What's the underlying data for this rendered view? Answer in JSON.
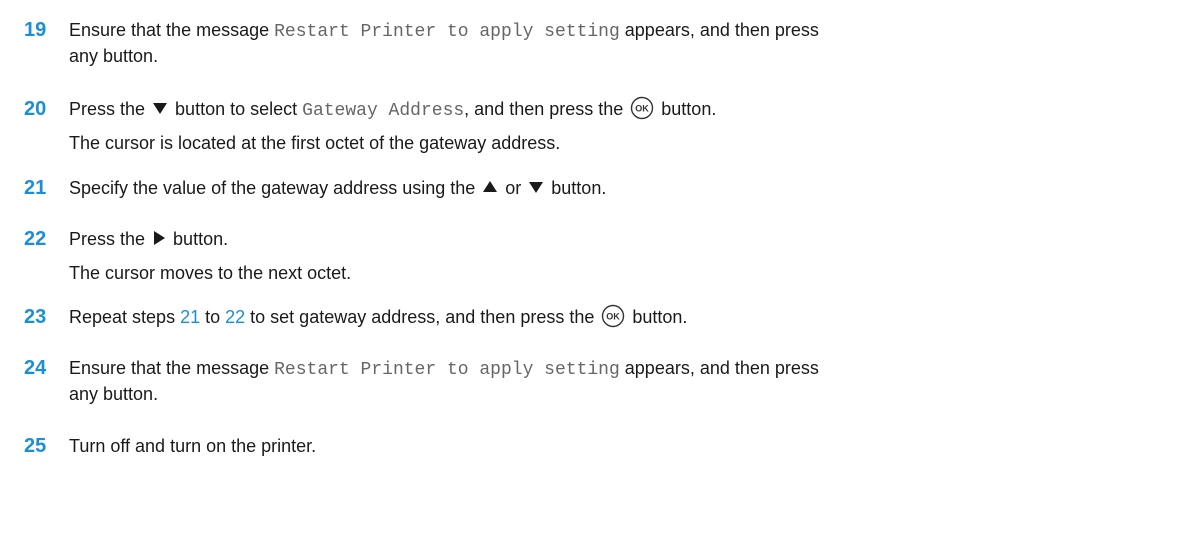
{
  "steps": [
    {
      "number": "19",
      "line1_pre": "Ensure that the message ",
      "line1_mono": "Restart Printer to apply setting",
      "line1_post": " appears, and then press",
      "line2": "any button."
    },
    {
      "number": "20",
      "pre": "Press the ",
      "mid1": " button to select ",
      "mono": "Gateway Address",
      "mid2": ", and then press the ",
      "post": " button.",
      "sub": "The cursor is located at the first octet of the gateway address."
    },
    {
      "number": "21",
      "pre": "Specify the value of the gateway address using the ",
      "mid": " or ",
      "post": " button."
    },
    {
      "number": "22",
      "pre": "Press the ",
      "post": " button.",
      "sub": "The cursor moves to the next octet."
    },
    {
      "number": "23",
      "pre": "Repeat steps ",
      "link1": "21",
      "mid1": " to ",
      "link2": "22",
      "mid2": " to set gateway address, and then press the ",
      "post": " button."
    },
    {
      "number": "24",
      "line1_pre": "Ensure that the message ",
      "line1_mono": "Restart Printer to apply setting",
      "line1_post": " appears, and then press",
      "line2": "any button."
    },
    {
      "number": "25",
      "text": "Turn off and turn on the printer."
    }
  ],
  "icons": {
    "ok_label": "OK",
    "down": "down-arrow-icon",
    "up": "up-arrow-icon",
    "right": "right-arrow-icon",
    "ok": "ok-button-icon"
  },
  "colors": {
    "accent": "#1a8fd6",
    "mono_text": "#666666",
    "body_text": "#1a1a1a"
  }
}
